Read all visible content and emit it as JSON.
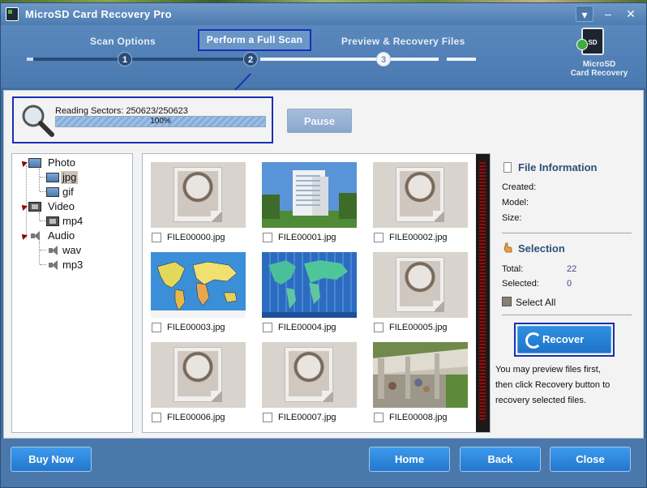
{
  "window": {
    "title": "MicroSD Card Recovery Pro"
  },
  "steps": [
    {
      "label": "Scan Options",
      "number": "1"
    },
    {
      "label": "Perform a Full Scan",
      "number": "2"
    },
    {
      "label": "Preview & Recovery Files",
      "number": "3"
    }
  ],
  "logo": {
    "card_text": "SD",
    "line1": "MicroSD",
    "line2": "Card Recovery"
  },
  "scan": {
    "status": "Reading Sectors: 250623/250623",
    "progress_text": "100%",
    "progress": 1.0,
    "pause_label": "Pause"
  },
  "tree": {
    "photo": "Photo",
    "jpg": "jpg",
    "gif": "gif",
    "video": "Video",
    "mp4": "mp4",
    "audio": "Audio",
    "wav": "wav",
    "mp3": "mp3"
  },
  "files": [
    "FILE00000.jpg",
    "FILE00001.jpg",
    "FILE00002.jpg",
    "FILE00003.jpg",
    "FILE00004.jpg",
    "FILE00005.jpg",
    "FILE00006.jpg",
    "FILE00007.jpg",
    "FILE00008.jpg"
  ],
  "info": {
    "file_info_title": "File Information",
    "created_label": "Created:",
    "model_label": "Model:",
    "size_label": "Size:",
    "selection_title": "Selection",
    "total_label": "Total:",
    "total_value": "22",
    "selected_label": "Selected:",
    "selected_value": "0",
    "select_all_label": "Select All",
    "recover_label": "Recover",
    "help_line1": "You may preview files first,",
    "help_line2": "then click Recovery button to",
    "help_line3": "recovery selected files."
  },
  "footer": {
    "buy_now": "Buy Now",
    "home": "Home",
    "back": "Back",
    "close": "Close"
  },
  "colors": {
    "accent_blue": "#1a2fb8",
    "button_blue": "#2377cc",
    "window_blue": "#4a78ab"
  }
}
